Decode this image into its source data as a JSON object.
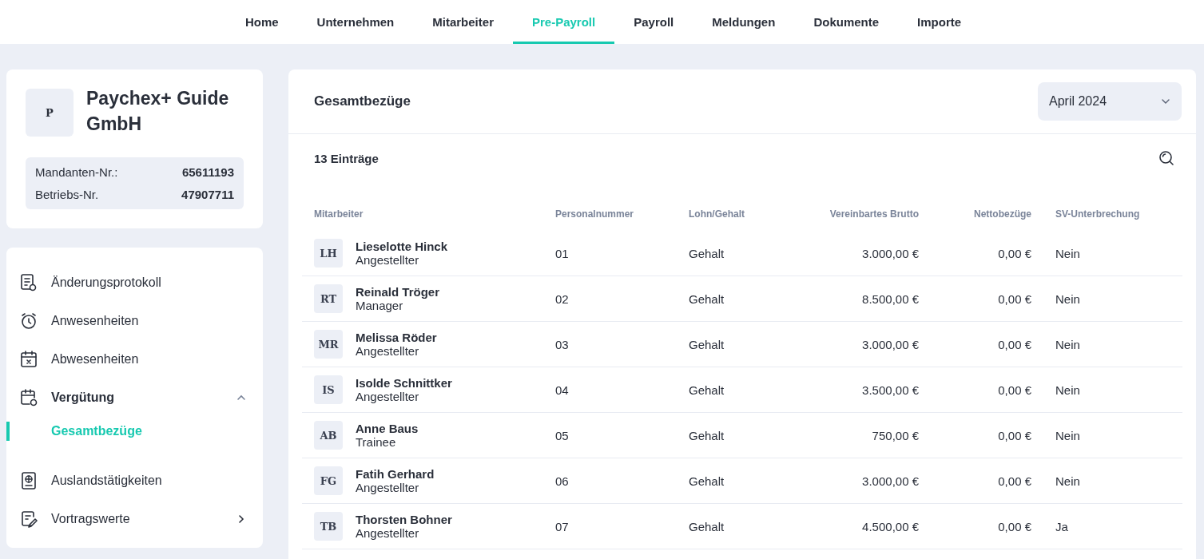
{
  "nav": [
    {
      "label": "Home",
      "selected": false
    },
    {
      "label": "Unternehmen",
      "selected": false
    },
    {
      "label": "Mitarbeiter",
      "selected": false
    },
    {
      "label": "Pre-Payroll",
      "selected": true
    },
    {
      "label": "Payroll",
      "selected": false
    },
    {
      "label": "Meldungen",
      "selected": false
    },
    {
      "label": "Dokumente",
      "selected": false
    },
    {
      "label": "Importe",
      "selected": false
    }
  ],
  "company": {
    "logo": "P",
    "name": "Paychex+ Guide GmbH",
    "details": [
      {
        "label": "Mandanten-Nr.:",
        "value": "65611193"
      },
      {
        "label": "Betriebs-Nr.",
        "value": "47907711"
      }
    ]
  },
  "sidebar": {
    "items": [
      {
        "label": "Änderungsprotokoll",
        "selected": false
      },
      {
        "label": "Anwesenheiten",
        "selected": false
      },
      {
        "label": "Abwesenheiten",
        "selected": false
      },
      {
        "label": "Vergütung",
        "selected": false,
        "expanded": true,
        "children": [
          {
            "label": "Gesamtbezüge",
            "selected": true
          }
        ]
      },
      {
        "label": "Auslandstätigkeiten",
        "selected": false
      },
      {
        "label": "Vortragswerte",
        "selected": false,
        "expanded": false
      }
    ]
  },
  "panel": {
    "title": "Gesamtbezüge",
    "period": "April 2024",
    "count": "13 Einträge"
  },
  "table": {
    "columns": [
      "Mitarbeiter",
      "Personalnummer",
      "Lohn/Gehalt",
      "Vereinbartes Brutto",
      "Nettobezüge",
      "SV-Unterbrechung"
    ],
    "rows": [
      {
        "initials": "LH",
        "name": "Lieselotte Hinck",
        "role": "Angestellter",
        "number": "01",
        "pay_type": "Gehalt",
        "gross": "3.000,00 €",
        "net": "0,00 €",
        "sv": "Nein"
      },
      {
        "initials": "RT",
        "name": "Reinald Tröger",
        "role": "Manager",
        "number": "02",
        "pay_type": "Gehalt",
        "gross": "8.500,00 €",
        "net": "0,00 €",
        "sv": "Nein"
      },
      {
        "initials": "MR",
        "name": "Melissa Röder",
        "role": "Angestellter",
        "number": "03",
        "pay_type": "Gehalt",
        "gross": "3.000,00 €",
        "net": "0,00 €",
        "sv": "Nein"
      },
      {
        "initials": "IS",
        "name": "Isolde Schnittker",
        "role": "Angestellter",
        "number": "04",
        "pay_type": "Gehalt",
        "gross": "3.500,00 €",
        "net": "0,00 €",
        "sv": "Nein"
      },
      {
        "initials": "AB",
        "name": "Anne Baus",
        "role": "Trainee",
        "number": "05",
        "pay_type": "Gehalt",
        "gross": "750,00 €",
        "net": "0,00 €",
        "sv": "Nein"
      },
      {
        "initials": "FG",
        "name": "Fatih Gerhard",
        "role": "Angestellter",
        "number": "06",
        "pay_type": "Gehalt",
        "gross": "3.000,00 €",
        "net": "0,00 €",
        "sv": "Nein"
      },
      {
        "initials": "TB",
        "name": "Thorsten Bohner",
        "role": "Angestellter",
        "number": "07",
        "pay_type": "Gehalt",
        "gross": "4.500,00 €",
        "net": "0,00 €",
        "sv": "Ja"
      }
    ]
  }
}
